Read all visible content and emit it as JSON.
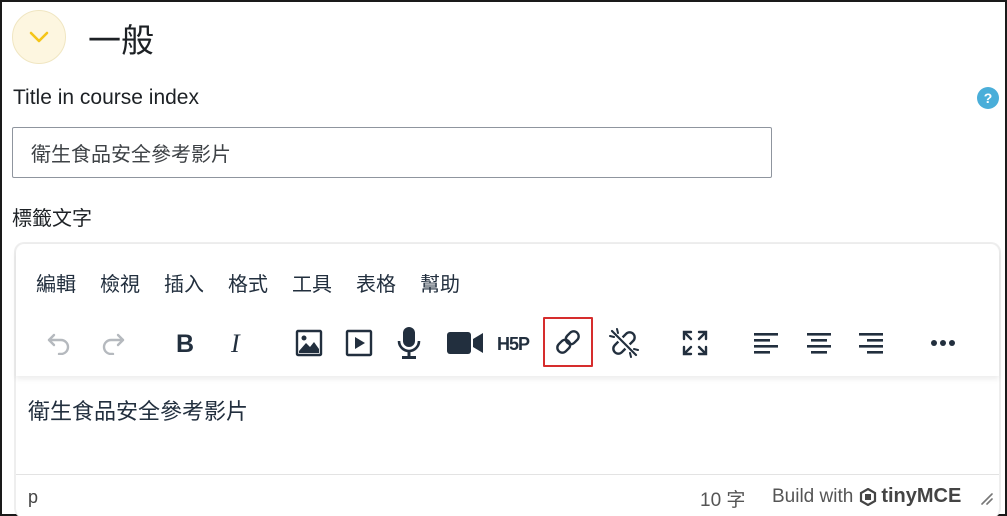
{
  "section": {
    "title": "一般",
    "toggle_icon": "chevron-down-icon",
    "toggle_color": "#f5c518"
  },
  "title_field": {
    "label": "Title in course index",
    "value": "衛生食品安全參考影片",
    "help_icon": "question-icon"
  },
  "label_field": {
    "label": "標籤文字"
  },
  "editor": {
    "menu": [
      "編輯",
      "檢視",
      "插入",
      "格式",
      "工具",
      "表格",
      "幫助"
    ],
    "toolbar": [
      {
        "icon": "undo-icon",
        "state": "disabled"
      },
      {
        "icon": "redo-icon",
        "state": "disabled"
      },
      {
        "icon": "bold-icon"
      },
      {
        "icon": "italic-icon"
      },
      {
        "icon": "image-icon"
      },
      {
        "icon": "media-icon"
      },
      {
        "icon": "microphone-icon"
      },
      {
        "icon": "video-camera-icon"
      },
      {
        "icon": "h5p-icon",
        "text": "H5P"
      },
      {
        "icon": "link-icon",
        "state": "highlighted"
      },
      {
        "icon": "unlink-icon"
      },
      {
        "icon": "fullscreen-icon"
      },
      {
        "icon": "align-left-icon"
      },
      {
        "icon": "align-center-icon"
      },
      {
        "icon": "align-right-icon"
      },
      {
        "icon": "more-icon"
      }
    ],
    "content": "衛生食品安全參考影片",
    "status": {
      "path": "p",
      "word_count": "10 字",
      "brand_prefix": "Build with",
      "brand_name": "tinyMCE"
    }
  },
  "colors": {
    "highlight_border": "#d62d2d",
    "help_badge": "#4aaed9",
    "toggle_bg": "#fdf6e0"
  }
}
